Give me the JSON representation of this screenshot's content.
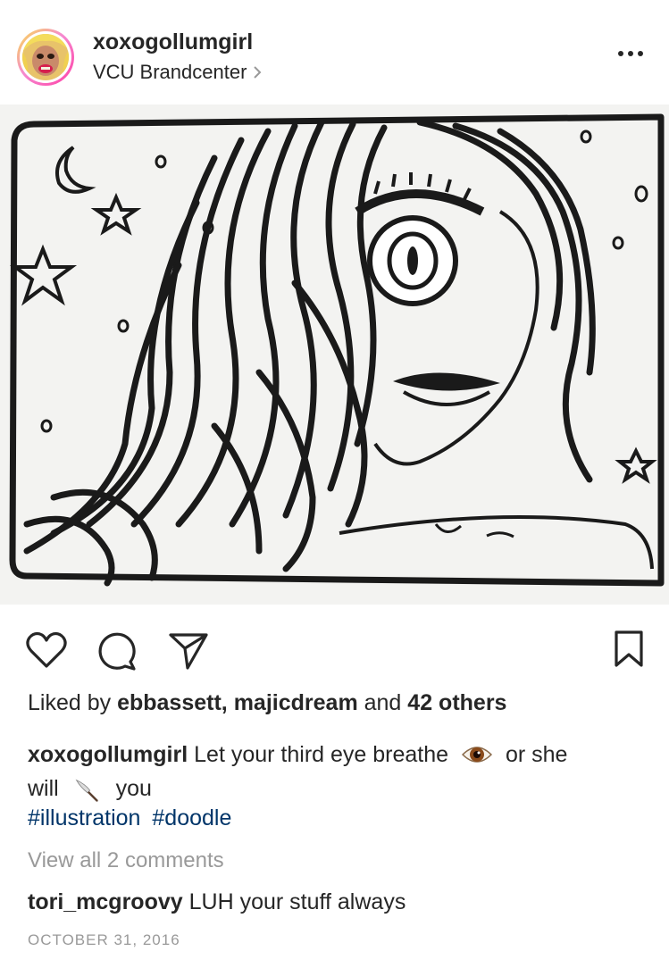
{
  "post": {
    "username": "xoxogollumgirl",
    "location": "VCU Brandcenter",
    "more_icon": "more-horizontal-icon"
  },
  "likes": {
    "prefix": "Liked by",
    "user1": "ebbassett,",
    "user2": "majicdream",
    "conj": "and",
    "others": "42 others"
  },
  "caption": {
    "username": "xoxogollumgirl",
    "text1": "Let your third eye breathe",
    "text2": "or she",
    "text3": "will",
    "text4": "you",
    "emoji1": "eye-emoji",
    "emoji2": "knife-emoji"
  },
  "hashtags": [
    "#illustration",
    "#doodle"
  ],
  "view_all": "View all 2 comments",
  "comment": {
    "username": "tori_mcgroovy",
    "text": "LUH your stuff always"
  },
  "date": "OCTOBER 31, 2016",
  "icons": {
    "like": "heart-icon",
    "comment": "comment-bubble-icon",
    "share": "send-icon",
    "save": "bookmark-icon"
  }
}
